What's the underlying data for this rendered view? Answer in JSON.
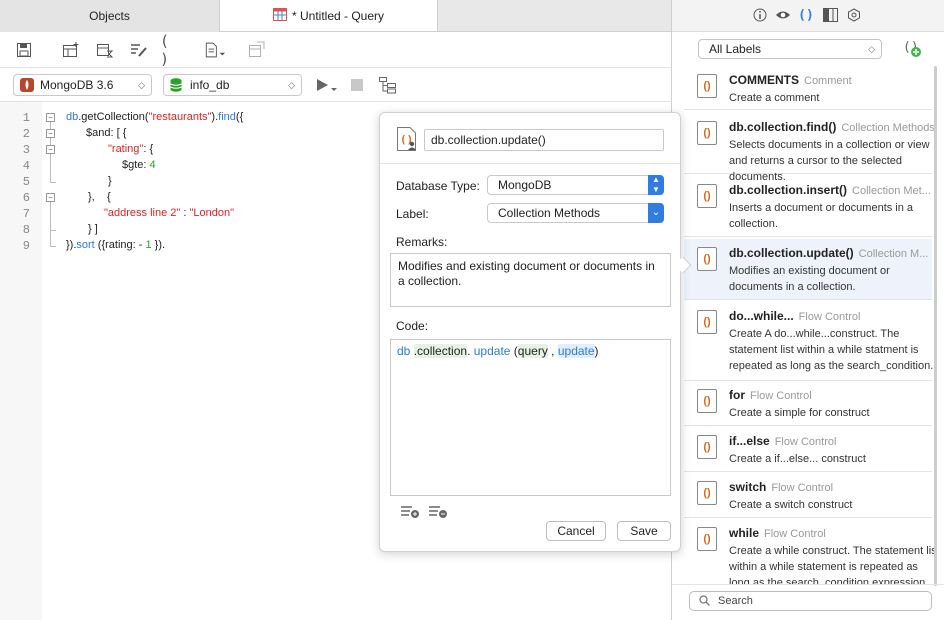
{
  "tabs": {
    "objects": "Objects",
    "query": "* Untitled - Query"
  },
  "connection": {
    "server": "MongoDB 3.6",
    "database": "info_db"
  },
  "editor": {
    "line_numbers": [
      "1",
      "2",
      "3",
      "4",
      "5",
      "6",
      "7",
      "8",
      "9"
    ]
  },
  "right_panel": {
    "label_filter": "All Labels",
    "search_placeholder": "Search",
    "snippets": [
      {
        "title": "COMMENTS",
        "category": "Comment",
        "description": "Create a comment"
      },
      {
        "title": "db.collection.find()",
        "category": "Collection Methods",
        "description": "Selects documents in a collection or view and returns a cursor to the selected documents."
      },
      {
        "title": "db.collection.insert()",
        "category": "Collection Met...",
        "description": "Inserts  a document or documents in a collection."
      },
      {
        "title": "db.collection.update()",
        "category": "Collection M...",
        "description": "Modifies an existing document or documents in  a collection."
      },
      {
        "title": "do...while...",
        "category": "Flow Control",
        "description": "Create A do...while...construct. The statement list within a while statment is repeated as long as the search_condition..."
      },
      {
        "title": "for",
        "category": "Flow Control",
        "description": "Create a simple for construct"
      },
      {
        "title": "if...else",
        "category": "Flow Control",
        "description": "Create a if...else... construct"
      },
      {
        "title": "switch",
        "category": "Flow Control",
        "description": "Create a switch construct"
      },
      {
        "title": "while",
        "category": "Flow Control",
        "description": "Create a while construct. The statement list within a while statement is repeated as long as the search_condition expression"
      }
    ]
  },
  "popover": {
    "name": "db.collection.update()",
    "database_type_label": "Database Type:",
    "database_type": "MongoDB",
    "label_label": "Label:",
    "label_value": "Collection Methods",
    "remarks_label": "Remarks:",
    "remarks": "Modifies and existing document or documents in a collection.",
    "code_label": "Code:",
    "cancel": "Cancel",
    "save": "Save"
  },
  "colors": {
    "keyword": "#2b7bd9",
    "string": "#dd2222",
    "number": "#2aa12a",
    "accent": "#2f7de1"
  }
}
